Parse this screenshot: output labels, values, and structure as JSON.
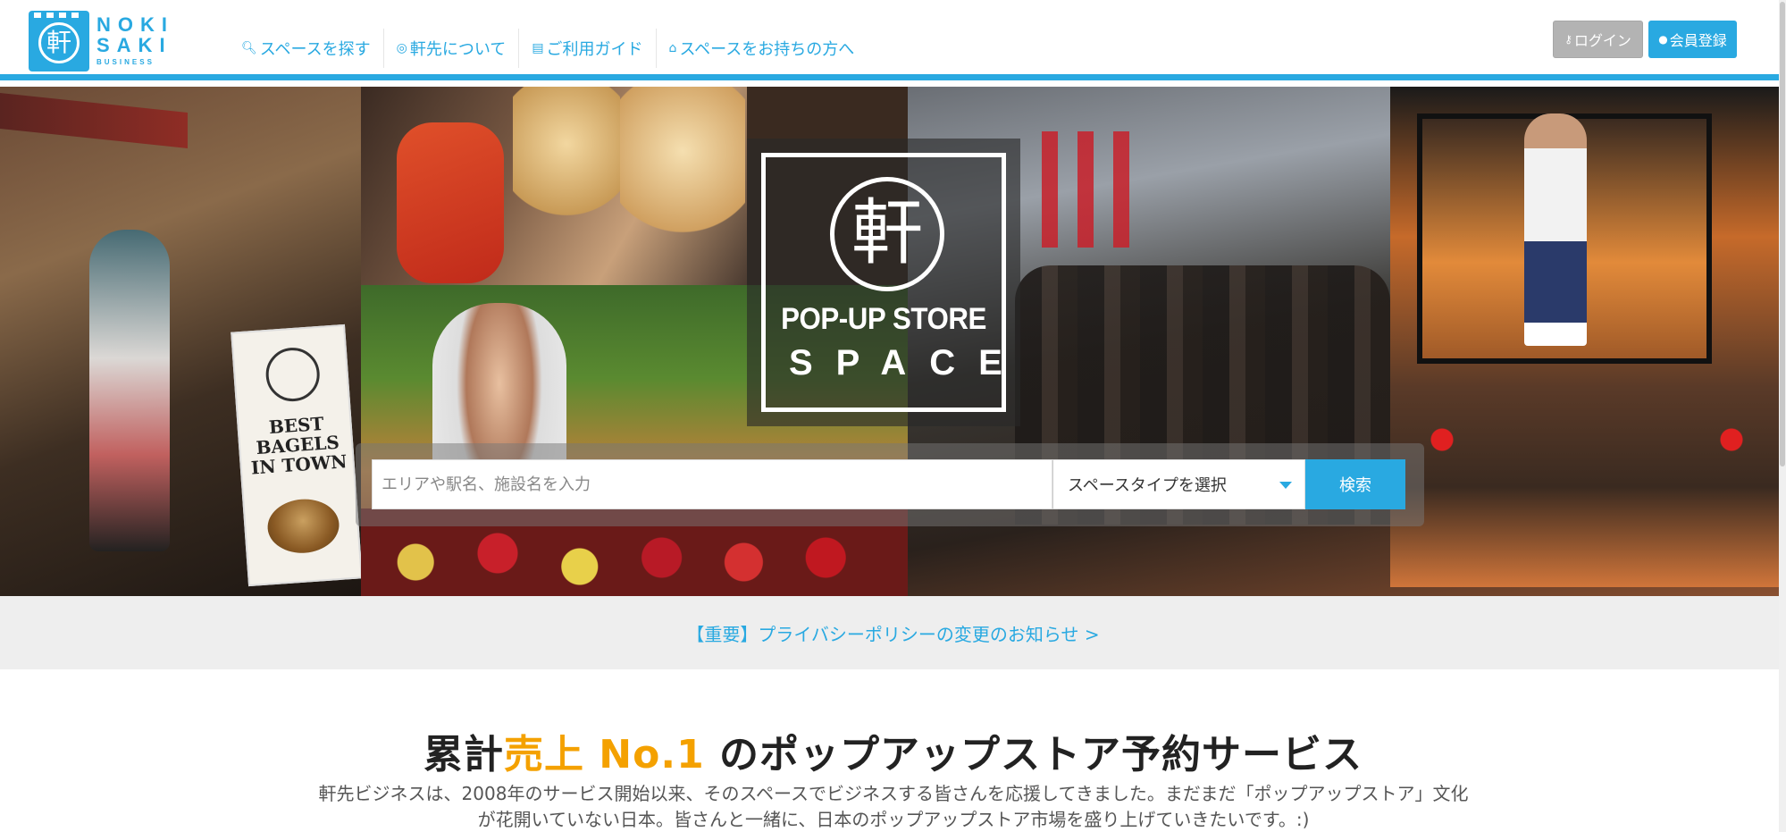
{
  "logo": {
    "mark": "軒",
    "line1": "NOKI",
    "line2": "SAKI",
    "line3": "BUSINESS"
  },
  "nav": {
    "items": [
      {
        "icon": "search-icon",
        "label": "スペースを探す"
      },
      {
        "icon": "globe-icon",
        "label": "軒先について"
      },
      {
        "icon": "book-icon",
        "label": "ご利用ガイド"
      },
      {
        "icon": "home-icon",
        "label": "スペースをお持ちの方へ"
      }
    ]
  },
  "auth": {
    "login_label": "ログイン",
    "register_label": "会員登録"
  },
  "hero": {
    "logo_mark": "軒",
    "title_line1": "POP-UP STORE",
    "title_line2": "SPACE",
    "banner_text": "BEST BAGELS IN TOWN"
  },
  "search": {
    "placeholder": "エリアや駅名、施設名を入力",
    "value": "",
    "type_select": "スペースタイプを選択",
    "button_label": "検索"
  },
  "notice": {
    "text": "【重要】プライバシーポリシーの変更のお知らせ >"
  },
  "main": {
    "headline_pre": "累計",
    "headline_hl": "売上 No.1",
    "headline_post": " のポップアップストア予約サービス",
    "lead_line1": "軒先ビジネスは、2008年のサービス開始以来、そのスペースでビジネスする皆さんを応援してきました。まだまだ「ポップアップストア」文化",
    "lead_line2": "が花開いていない日本。皆さんと一緒に、日本のポップアップストア市場を盛り上げていきたいです。:)"
  },
  "colors": {
    "accent": "#29a9e1",
    "highlight": "#f4a100",
    "login_bg": "#b3b3b3"
  }
}
